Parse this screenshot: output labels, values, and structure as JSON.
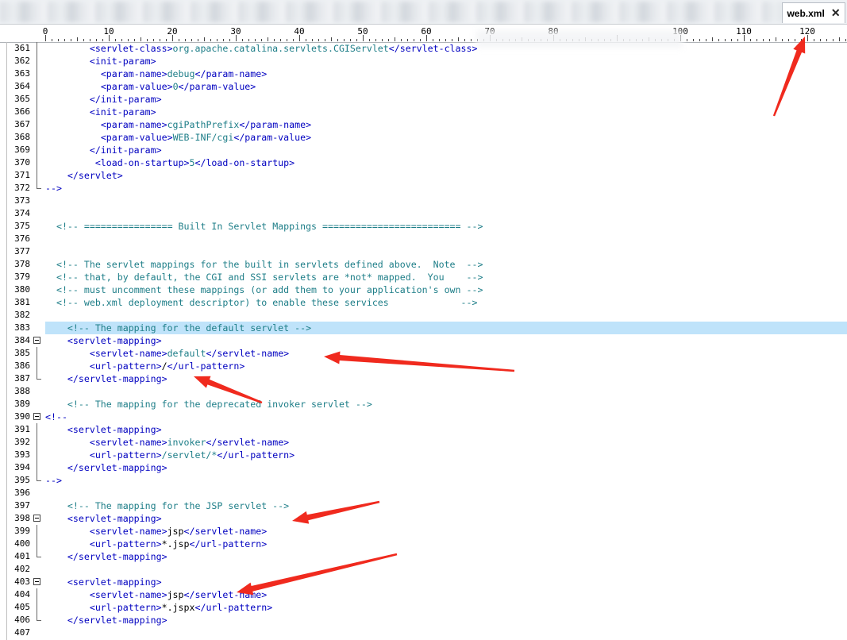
{
  "tab": {
    "title": "web.xml",
    "close": "✕"
  },
  "ruler": {
    "labels": [
      "0",
      "10",
      "20",
      "30",
      "40",
      "50",
      "60",
      "70",
      "80",
      "100",
      "110",
      "120"
    ]
  },
  "lines": [
    {
      "num": "361",
      "fold": "guide",
      "segs": [
        [
          "txt",
          "        "
        ],
        [
          "tag",
          "<servlet-class>"
        ],
        [
          "cmt",
          "org.apache.catalina.servlets.CGIServlet"
        ],
        [
          "tag",
          "</servlet-class>"
        ]
      ]
    },
    {
      "num": "362",
      "fold": "guide",
      "segs": [
        [
          "txt",
          "        "
        ],
        [
          "tag",
          "<init-param>"
        ]
      ]
    },
    {
      "num": "363",
      "fold": "guide",
      "segs": [
        [
          "txt",
          "          "
        ],
        [
          "tag",
          "<param-name>"
        ],
        [
          "cmt",
          "debug"
        ],
        [
          "tag",
          "</param-name>"
        ]
      ]
    },
    {
      "num": "364",
      "fold": "guide",
      "segs": [
        [
          "txt",
          "          "
        ],
        [
          "tag",
          "<param-value>"
        ],
        [
          "cmt",
          "0"
        ],
        [
          "tag",
          "</param-value>"
        ]
      ]
    },
    {
      "num": "365",
      "fold": "guide",
      "segs": [
        [
          "txt",
          "        "
        ],
        [
          "tag",
          "</init-param>"
        ]
      ]
    },
    {
      "num": "366",
      "fold": "guide",
      "segs": [
        [
          "txt",
          "        "
        ],
        [
          "tag",
          "<init-param>"
        ]
      ]
    },
    {
      "num": "367",
      "fold": "guide",
      "segs": [
        [
          "txt",
          "          "
        ],
        [
          "tag",
          "<param-name>"
        ],
        [
          "cmt",
          "cgiPathPrefix"
        ],
        [
          "tag",
          "</param-name>"
        ]
      ]
    },
    {
      "num": "368",
      "fold": "guide",
      "segs": [
        [
          "txt",
          "          "
        ],
        [
          "tag",
          "<param-value>"
        ],
        [
          "cmt",
          "WEB-INF/cgi"
        ],
        [
          "tag",
          "</param-value>"
        ]
      ]
    },
    {
      "num": "369",
      "fold": "guide",
      "segs": [
        [
          "txt",
          "        "
        ],
        [
          "tag",
          "</init-param>"
        ]
      ]
    },
    {
      "num": "370",
      "fold": "guide",
      "segs": [
        [
          "txt",
          "         "
        ],
        [
          "tag",
          "<load-on-startup>"
        ],
        [
          "cmt",
          "5"
        ],
        [
          "tag",
          "</load-on-startup>"
        ]
      ]
    },
    {
      "num": "371",
      "fold": "guide",
      "segs": [
        [
          "txt",
          "    "
        ],
        [
          "tag",
          "</servlet>"
        ]
      ]
    },
    {
      "num": "372",
      "fold": "end",
      "segs": [
        [
          "tag",
          "-->"
        ]
      ]
    },
    {
      "num": "373",
      "fold": "",
      "segs": []
    },
    {
      "num": "374",
      "fold": "",
      "segs": []
    },
    {
      "num": "375",
      "fold": "",
      "segs": [
        [
          "txt",
          "  "
        ],
        [
          "cmt",
          "<!-- ================ Built In Servlet Mappings ========================= -->"
        ]
      ]
    },
    {
      "num": "376",
      "fold": "",
      "segs": []
    },
    {
      "num": "377",
      "fold": "",
      "segs": []
    },
    {
      "num": "378",
      "fold": "",
      "segs": [
        [
          "txt",
          "  "
        ],
        [
          "cmt",
          "<!-- The servlet mappings for the built in servlets defined above.  Note  -->"
        ]
      ]
    },
    {
      "num": "379",
      "fold": "",
      "segs": [
        [
          "txt",
          "  "
        ],
        [
          "cmt",
          "<!-- that, by default, the CGI and SSI servlets are *not* mapped.  You    -->"
        ]
      ]
    },
    {
      "num": "380",
      "fold": "",
      "segs": [
        [
          "txt",
          "  "
        ],
        [
          "cmt",
          "<!-- must uncomment these mappings (or add them to your application's own -->"
        ]
      ]
    },
    {
      "num": "381",
      "fold": "",
      "segs": [
        [
          "txt",
          "  "
        ],
        [
          "cmt",
          "<!-- web.xml deployment descriptor) to enable these services             -->"
        ]
      ]
    },
    {
      "num": "382",
      "fold": "",
      "segs": []
    },
    {
      "num": "383",
      "fold": "",
      "hl": true,
      "segs": [
        [
          "txt",
          "    "
        ],
        [
          "cmt",
          "<!-- The mapping for the default servlet -->"
        ]
      ]
    },
    {
      "num": "384",
      "fold": "box",
      "segs": [
        [
          "txt",
          "    "
        ],
        [
          "tag",
          "<servlet-mapping>"
        ]
      ]
    },
    {
      "num": "385",
      "fold": "guide",
      "segs": [
        [
          "txt",
          "        "
        ],
        [
          "tag",
          "<servlet-name>"
        ],
        [
          "cmt",
          "default"
        ],
        [
          "tag",
          "</servlet-name>"
        ]
      ]
    },
    {
      "num": "386",
      "fold": "guide",
      "segs": [
        [
          "txt",
          "        "
        ],
        [
          "tag",
          "<url-pattern>"
        ],
        [
          "txt",
          "/"
        ],
        [
          "tag",
          "</url-pattern>"
        ]
      ]
    },
    {
      "num": "387",
      "fold": "end",
      "segs": [
        [
          "txt",
          "    "
        ],
        [
          "tag",
          "</servlet-mapping>"
        ]
      ]
    },
    {
      "num": "388",
      "fold": "",
      "segs": []
    },
    {
      "num": "389",
      "fold": "",
      "segs": [
        [
          "txt",
          "    "
        ],
        [
          "cmt",
          "<!-- The mapping for the deprecated invoker servlet -->"
        ]
      ]
    },
    {
      "num": "390",
      "fold": "box",
      "segs": [
        [
          "tag",
          "<!--"
        ]
      ]
    },
    {
      "num": "391",
      "fold": "guide",
      "segs": [
        [
          "txt",
          "    "
        ],
        [
          "tag",
          "<servlet-mapping>"
        ]
      ]
    },
    {
      "num": "392",
      "fold": "guide",
      "segs": [
        [
          "txt",
          "        "
        ],
        [
          "tag",
          "<servlet-name>"
        ],
        [
          "cmt",
          "invoker"
        ],
        [
          "tag",
          "</servlet-name>"
        ]
      ]
    },
    {
      "num": "393",
      "fold": "guide",
      "segs": [
        [
          "txt",
          "        "
        ],
        [
          "tag",
          "<url-pattern>"
        ],
        [
          "cmt",
          "/servlet/*"
        ],
        [
          "tag",
          "</url-pattern>"
        ]
      ]
    },
    {
      "num": "394",
      "fold": "guide",
      "segs": [
        [
          "txt",
          "    "
        ],
        [
          "tag",
          "</servlet-mapping>"
        ]
      ]
    },
    {
      "num": "395",
      "fold": "end",
      "segs": [
        [
          "tag",
          "-->"
        ]
      ]
    },
    {
      "num": "396",
      "fold": "",
      "segs": []
    },
    {
      "num": "397",
      "fold": "",
      "segs": [
        [
          "txt",
          "    "
        ],
        [
          "cmt",
          "<!-- The mapping for the JSP servlet -->"
        ]
      ]
    },
    {
      "num": "398",
      "fold": "box",
      "segs": [
        [
          "txt",
          "    "
        ],
        [
          "tag",
          "<servlet-mapping>"
        ]
      ]
    },
    {
      "num": "399",
      "fold": "guide",
      "segs": [
        [
          "txt",
          "        "
        ],
        [
          "tag",
          "<servlet-name>"
        ],
        [
          "txt",
          "jsp"
        ],
        [
          "tag",
          "</servlet-name>"
        ]
      ]
    },
    {
      "num": "400",
      "fold": "guide",
      "segs": [
        [
          "txt",
          "        "
        ],
        [
          "tag",
          "<url-pattern>"
        ],
        [
          "txt",
          "*.jsp"
        ],
        [
          "tag",
          "</url-pattern>"
        ]
      ]
    },
    {
      "num": "401",
      "fold": "end",
      "segs": [
        [
          "txt",
          "    "
        ],
        [
          "tag",
          "</servlet-mapping>"
        ]
      ]
    },
    {
      "num": "402",
      "fold": "",
      "segs": []
    },
    {
      "num": "403",
      "fold": "box",
      "segs": [
        [
          "txt",
          "    "
        ],
        [
          "tag",
          "<servlet-mapping>"
        ]
      ]
    },
    {
      "num": "404",
      "fold": "guide",
      "segs": [
        [
          "txt",
          "        "
        ],
        [
          "tag",
          "<servlet-name>"
        ],
        [
          "txt",
          "jsp"
        ],
        [
          "tag",
          "</servlet-name>"
        ]
      ]
    },
    {
      "num": "405",
      "fold": "guide",
      "segs": [
        [
          "txt",
          "        "
        ],
        [
          "tag",
          "<url-pattern>"
        ],
        [
          "txt",
          "*.jspx"
        ],
        [
          "tag",
          "</url-pattern>"
        ]
      ]
    },
    {
      "num": "406",
      "fold": "end",
      "segs": [
        [
          "txt",
          "    "
        ],
        [
          "tag",
          "</servlet-mapping>"
        ]
      ]
    },
    {
      "num": "407",
      "fold": "",
      "segs": []
    }
  ],
  "colors": {
    "tag": "#0000c0",
    "comment": "#1e7e88",
    "highlight": "#bfe3fa",
    "arrow": "#f02a1e"
  }
}
